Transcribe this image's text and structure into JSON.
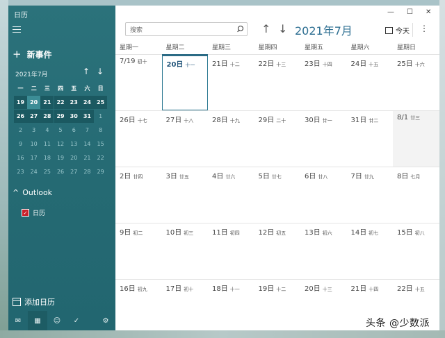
{
  "app": {
    "title": "日历"
  },
  "sidebar": {
    "new_event": "新事件",
    "mini_calendar": {
      "month_label": "2021年7月",
      "weekdays": [
        "一",
        "二",
        "三",
        "四",
        "五",
        "六",
        "日"
      ],
      "weeks": [
        [
          "19",
          "20",
          "21",
          "22",
          "23",
          "24",
          "25"
        ],
        [
          "26",
          "27",
          "28",
          "29",
          "30",
          "31",
          "1"
        ],
        [
          "2",
          "3",
          "4",
          "5",
          "6",
          "7",
          "8"
        ],
        [
          "9",
          "10",
          "11",
          "12",
          "13",
          "14",
          "15"
        ],
        [
          "16",
          "17",
          "18",
          "19",
          "20",
          "21",
          "22"
        ],
        [
          "23",
          "24",
          "25",
          "26",
          "27",
          "28",
          "29"
        ]
      ],
      "today": "20"
    },
    "account_group": "Outlook",
    "calendar_name": "日历",
    "calendar_checked": true,
    "add_calendar": "添加日历",
    "bottom_icons": [
      "mail-icon",
      "calendar-icon",
      "people-icon",
      "todo-icon",
      "gear-icon"
    ]
  },
  "toolbar": {
    "search_placeholder": "搜索",
    "month_title": "2021年7月",
    "today_label": "今天",
    "more_label": "⋮"
  },
  "window_controls": [
    "—",
    "☐",
    "✕"
  ],
  "month_view": {
    "weekdays": [
      "星期一",
      "星期二",
      "星期三",
      "星期四",
      "星期五",
      "星期六",
      "星期日"
    ],
    "weeks": [
      [
        {
          "d": "7/19",
          "l": "初十"
        },
        {
          "d": "20日",
          "l": "十一",
          "today": true
        },
        {
          "d": "21日",
          "l": "十二"
        },
        {
          "d": "22日",
          "l": "十三"
        },
        {
          "d": "23日",
          "l": "十四"
        },
        {
          "d": "24日",
          "l": "十五"
        },
        {
          "d": "25日",
          "l": "十六"
        }
      ],
      [
        {
          "d": "26日",
          "l": "十七"
        },
        {
          "d": "27日",
          "l": "十八"
        },
        {
          "d": "28日",
          "l": "十九"
        },
        {
          "d": "29日",
          "l": "二十"
        },
        {
          "d": "30日",
          "l": "廿一"
        },
        {
          "d": "31日",
          "l": "廿二"
        },
        {
          "d": "8/1",
          "l": "廿三",
          "other": true
        }
      ],
      [
        {
          "d": "2日",
          "l": "廿四"
        },
        {
          "d": "3日",
          "l": "廿五"
        },
        {
          "d": "4日",
          "l": "廿六"
        },
        {
          "d": "5日",
          "l": "廿七"
        },
        {
          "d": "6日",
          "l": "廿八"
        },
        {
          "d": "7日",
          "l": "廿九"
        },
        {
          "d": "8日",
          "l": "七月"
        }
      ],
      [
        {
          "d": "9日",
          "l": "初二"
        },
        {
          "d": "10日",
          "l": "初三"
        },
        {
          "d": "11日",
          "l": "初四"
        },
        {
          "d": "12日",
          "l": "初五"
        },
        {
          "d": "13日",
          "l": "初六"
        },
        {
          "d": "14日",
          "l": "初七"
        },
        {
          "d": "15日",
          "l": "初八"
        }
      ],
      [
        {
          "d": "16日",
          "l": "初九"
        },
        {
          "d": "17日",
          "l": "初十"
        },
        {
          "d": "18日",
          "l": "十一"
        },
        {
          "d": "19日",
          "l": "十二"
        },
        {
          "d": "20日",
          "l": "十三"
        },
        {
          "d": "21日",
          "l": "十四"
        },
        {
          "d": "22日",
          "l": "十五"
        }
      ]
    ]
  },
  "watermark": "头条 @少数派"
}
